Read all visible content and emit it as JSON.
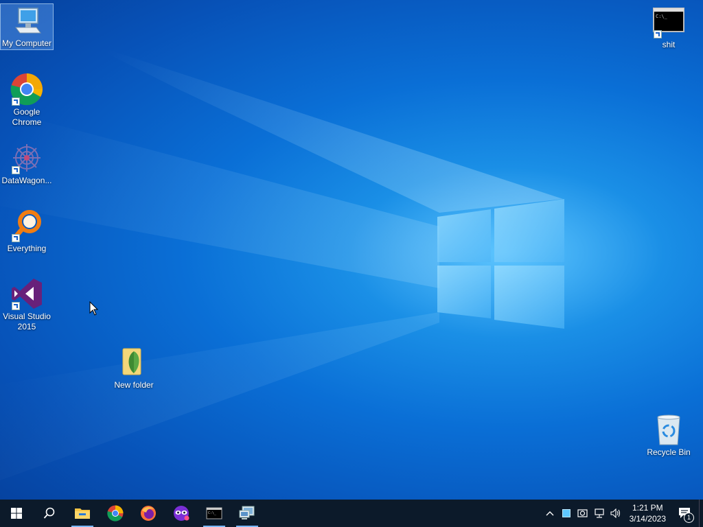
{
  "desktop": {
    "icons": [
      {
        "label": "My Computer"
      },
      {
        "label": "Google Chrome"
      },
      {
        "label": "DataWagon..."
      },
      {
        "label": "Everything"
      },
      {
        "label": "Visual Studio 2015"
      },
      {
        "label": "New folder"
      },
      {
        "label": "shit"
      },
      {
        "label": "Recycle Bin"
      }
    ]
  },
  "taskbar": {
    "buttons": [
      {
        "name": "start",
        "icon": "windows-logo-icon"
      },
      {
        "name": "search",
        "icon": "search-icon"
      },
      {
        "name": "file-explorer",
        "icon": "folder-icon",
        "running": true
      },
      {
        "name": "chrome",
        "icon": "chrome-icon"
      },
      {
        "name": "firefox",
        "icon": "firefox-icon"
      },
      {
        "name": "private-browser",
        "icon": "mask-icon"
      },
      {
        "name": "command-prompt",
        "icon": "terminal-icon",
        "running": true
      },
      {
        "name": "remote-desktop",
        "icon": "remote-desktop-icon",
        "running": true
      }
    ],
    "tray": {
      "time": "1:21 PM",
      "date": "3/14/2023",
      "notification_count": "1"
    }
  },
  "colors": {
    "accent": "#0a6fd6",
    "taskbar": "#0c1a2a"
  }
}
